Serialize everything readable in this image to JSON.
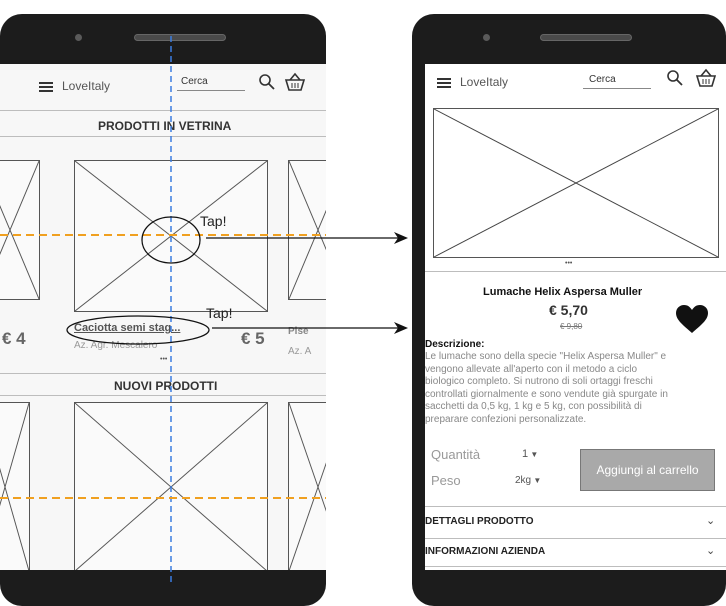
{
  "left": {
    "header": {
      "app_name": "LoveItaly",
      "search_placeholder": "Cerca"
    },
    "section_showcase": "PRODOTTI IN VETRINA",
    "price_left": "€ 4",
    "price_right": "€ 5",
    "product_name": "Caciotta semi stag...",
    "producer": "Az. Agr. Mescalero",
    "next_name_fragment": "Pise",
    "next_producer_fragment": "Az. A",
    "more_dots": "•••",
    "section_new": "NUOVI PRODOTTI"
  },
  "annotations": {
    "tap_image": "Tap!",
    "tap_name": "Tap!"
  },
  "right": {
    "header": {
      "app_name": "LoveItaly",
      "search_placeholder": "Cerca"
    },
    "carousel_dots": "•••",
    "product_title": "Lumache Helix Aspersa Muller",
    "price": "€ 5,70",
    "old_price": "€ 9,80",
    "description_label": "Descrizione:",
    "description_lines": [
      "Le lumache sono della specie \"Helix Aspersa Muller\" e",
      "vengono allevate all'aperto con il metodo a ciclo",
      "biologico completo. Si nutrono di soli ortaggi freschi",
      "controllati giornalmente e sono vendute già spurgate in",
      "sacchetti da 0,5 kg, 1 kg e 5 kg, con possibilità di",
      "preparare confezioni personalizzate."
    ],
    "quantity_label": "Quantità",
    "quantity_value": "1",
    "weight_label": "Peso",
    "weight_value": "2kg",
    "add_to_cart": "Aggiungi al carrello",
    "accordion_details": "DETTAGLI PRODOTTO",
    "accordion_company": "INFORMAZIONI AZIENDA"
  },
  "icons": [
    "menu-icon",
    "search-icon",
    "basket-icon",
    "heart-icon",
    "chevron-down-icon",
    "arrow-right-icon"
  ],
  "colors": {
    "phone_frame": "#1c1c1c",
    "guide_blue": "#3b7de0",
    "guide_orange": "#f0a020",
    "button_grey": "#a9a9a9"
  }
}
